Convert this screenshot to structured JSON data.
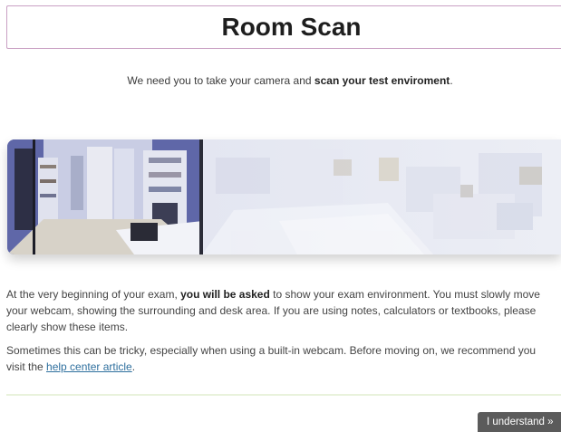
{
  "header": {
    "title": "Room Scan"
  },
  "intro": {
    "text_before": "We need you to take your camera and ",
    "text_bold": "scan your test enviroment",
    "text_after": "."
  },
  "body": {
    "paragraph1": {
      "before": "At the very beginning of your exam, ",
      "bold": "you will be asked",
      "after": " to show your exam environment. You must slowly move your webcam, showing the surrounding and desk area. If you are using notes, calculators or textbooks, please clearly show these items."
    },
    "paragraph2": {
      "before": "Sometimes this can be tricky, especially when using a built-in webcam. Before moving on, we recommend you visit the ",
      "link": "help center article",
      "after": "."
    }
  },
  "footer": {
    "button_label": "I understand »"
  },
  "colors": {
    "title_border": "#c9a0c3",
    "link": "#2e6f9e",
    "button_bg": "#5b5b5b",
    "divider": "#e9f2dc"
  }
}
